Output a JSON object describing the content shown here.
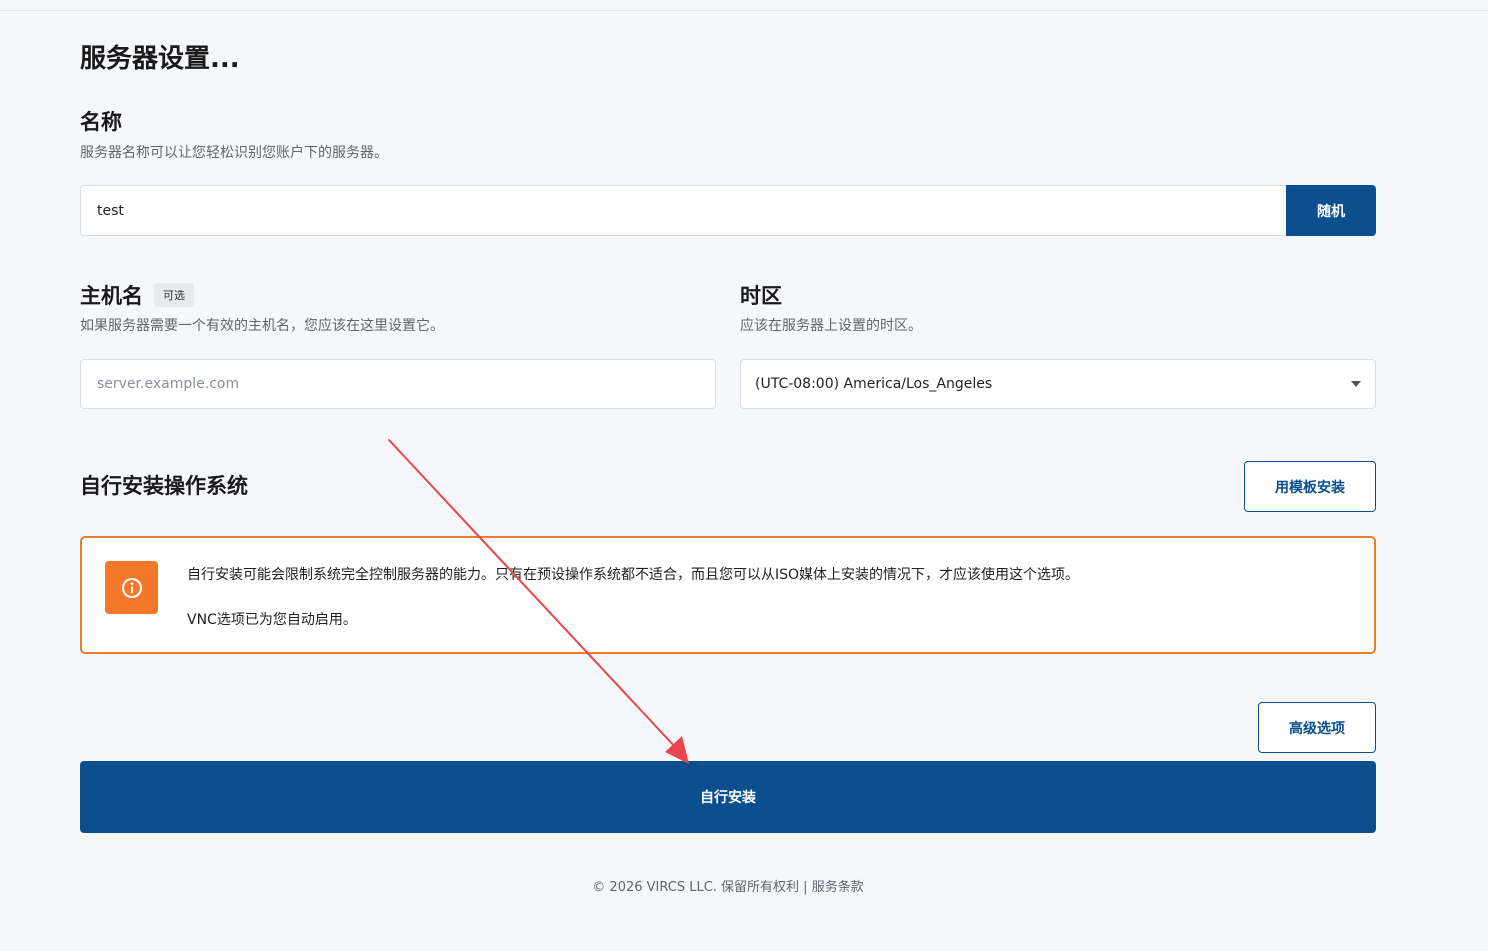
{
  "page": {
    "title": "服务器设置..."
  },
  "name_section": {
    "title": "名称",
    "description": "服务器名称可以让您轻松识别您账户下的服务器。",
    "value": "test",
    "random_button": "随机"
  },
  "hostname_section": {
    "title": "主机名",
    "badge": "可选",
    "description": "如果服务器需要一个有效的主机名，您应该在这里设置它。",
    "placeholder": "server.example.com"
  },
  "timezone_section": {
    "title": "时区",
    "description": "应该在服务器上设置的时区。",
    "selected": "(UTC-08:00) America/Los_Angeles"
  },
  "os_section": {
    "title": "自行安装操作系统",
    "template_button": "用模板安装"
  },
  "alert": {
    "message": "自行安装可能会限制系统完全控制服务器的能力。只有在预设操作系统都不适合，而且您可以从ISO媒体上安装的情况下，才应该使用这个选项。",
    "vnc_note": "VNC选项已为您自动启用。",
    "icon": "info-icon",
    "accent_color": "#f5782a"
  },
  "advanced_button": "高级选项",
  "install_button": "自行安装",
  "footer": {
    "text": "© 2026 VIRCS LLC. 保留所有权利 | 服务条款"
  },
  "annotation": {
    "type": "red-arrow",
    "color": "#e8474a"
  },
  "colors": {
    "primary": "#0b4f8f",
    "warning": "#f07a2b",
    "background": "#f5f7fa"
  }
}
